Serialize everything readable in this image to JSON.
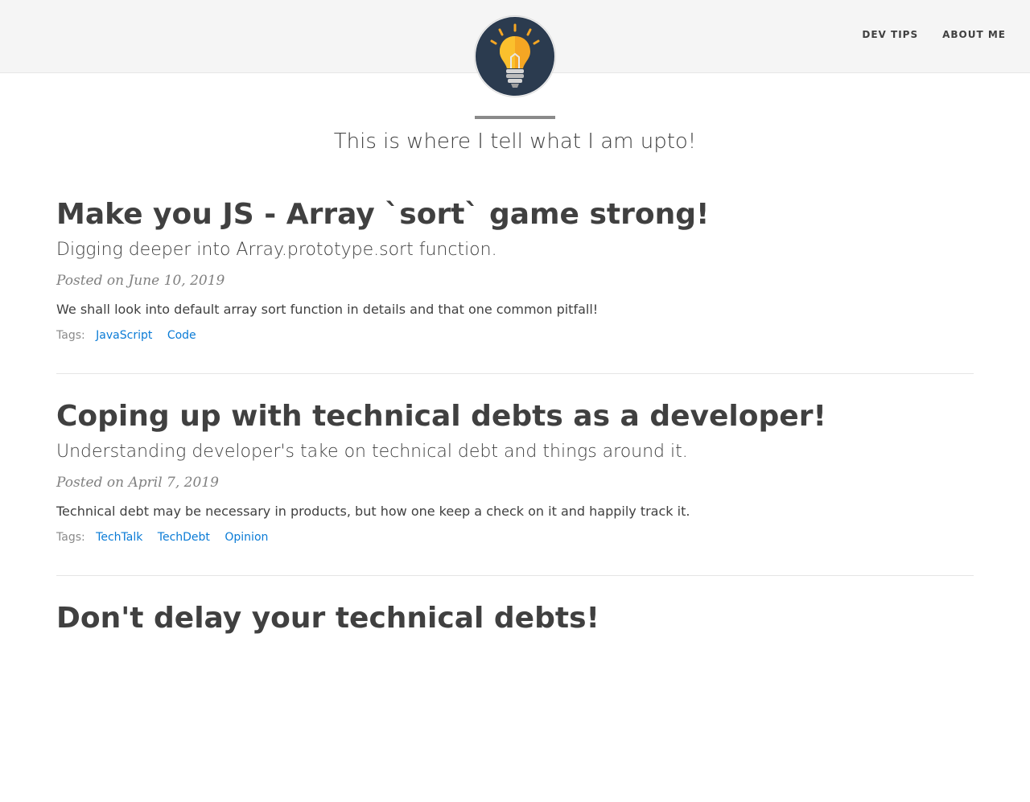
{
  "nav": {
    "links": [
      {
        "label": "DEV TIPS"
      },
      {
        "label": "ABOUT ME"
      }
    ]
  },
  "header": {
    "logo_icon": "lightbulb-icon",
    "subtitle": "This is where I tell what I am upto!"
  },
  "posts": [
    {
      "title": "Make you JS - Array `sort` game strong!",
      "subtitle": "Digging deeper into Array.prototype.sort function.",
      "meta": "Posted on June 10, 2019",
      "excerpt": "We shall look into default array sort function in details and that one common pitfall!",
      "tags_label": "Tags:",
      "tags": [
        "JavaScript",
        "Code"
      ]
    },
    {
      "title": "Coping up with technical debts as a developer!",
      "subtitle": "Understanding developer's take on technical debt and things around it.",
      "meta": "Posted on April 7, 2019",
      "excerpt": "Technical debt may be necessary in products, but how one keep a check on it and happily track it.",
      "tags_label": "Tags:",
      "tags": [
        "TechTalk",
        "TechDebt",
        "Opinion"
      ]
    },
    {
      "title": "Don't delay your technical debts!"
    }
  ],
  "colors": {
    "navbar_bg": "#f5f5f5",
    "text": "#404040",
    "meta": "#808080",
    "tag_link": "#0a7bd6",
    "avatar_bg": "#2b3b4f",
    "bulb": "#f5a623"
  }
}
